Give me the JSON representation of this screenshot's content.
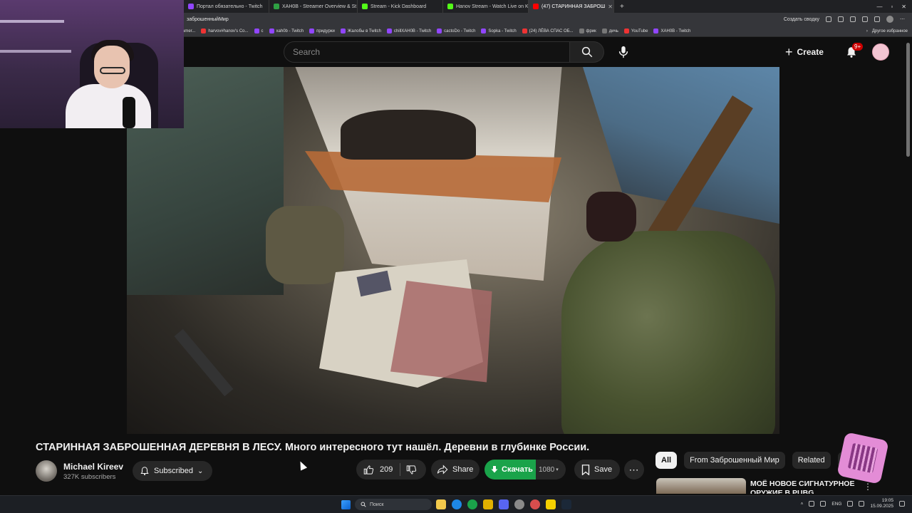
{
  "browser": {
    "tabs": [
      {
        "title": "Портал обязательно - Twitch",
        "color": "#9146ff"
      },
      {
        "title": "XAH0B - Streamer Overview & St",
        "color": "#2ea043"
      },
      {
        "title": "Stream - Kick Dashboard",
        "color": "#53fc18"
      },
      {
        "title": "Hanov Stream - Watch Live on K",
        "color": "#53fc18"
      },
      {
        "title": "(47) СТАРИННАЯ ЗАБРОШ",
        "color": "#ff0000"
      }
    ],
    "address": "заброшенныйМир",
    "address_right": "Создать сводку",
    "bookmarks": [
      "amer...",
      "harvov#hanov's Co...",
      "c",
      "xah0b - Twitch",
      "придурки",
      "Жалобы в Twitch",
      "chillXAH0B - Twitch",
      "cactoDo - Twitch",
      "Sopka - Twitch",
      "(24) ЛЁВА СПАС ОБ...",
      "фрик",
      "дичь",
      "YouTube",
      "XAH0B - Twitch"
    ],
    "bookmarks_right": "Другое избранное"
  },
  "youtube": {
    "search_placeholder": "Search",
    "create_label": "Create",
    "notification_count": "9+",
    "video_title": "СТАРИННАЯ ЗАБРОШЕННАЯ ДЕРЕВНЯ В ЛЕСУ. Много интересного тут нашёл. Деревни в глубинке России.",
    "channel_name": "Michael Kireev",
    "subscribers": "327K subscribers",
    "subscribed_label": "Subscribed",
    "likes": "209",
    "share_label": "Share",
    "download_label": "Скачать",
    "quality": "1080",
    "save_label": "Save",
    "chips": [
      "All",
      "From Заброшенный Мир",
      "Related",
      "F"
    ],
    "recommendation_title": "МОЁ НОВОЕ СИГНАТУРНОЕ ОРУЖИЕ В PUBG"
  },
  "taskbar": {
    "search_label": "Поиск",
    "language": "ENG",
    "time": "19:05",
    "date": "15.09.2025"
  },
  "colors": {
    "accent_red": "#cc0000",
    "download_green": "#1aa34a",
    "background": "#0f0f0f"
  }
}
